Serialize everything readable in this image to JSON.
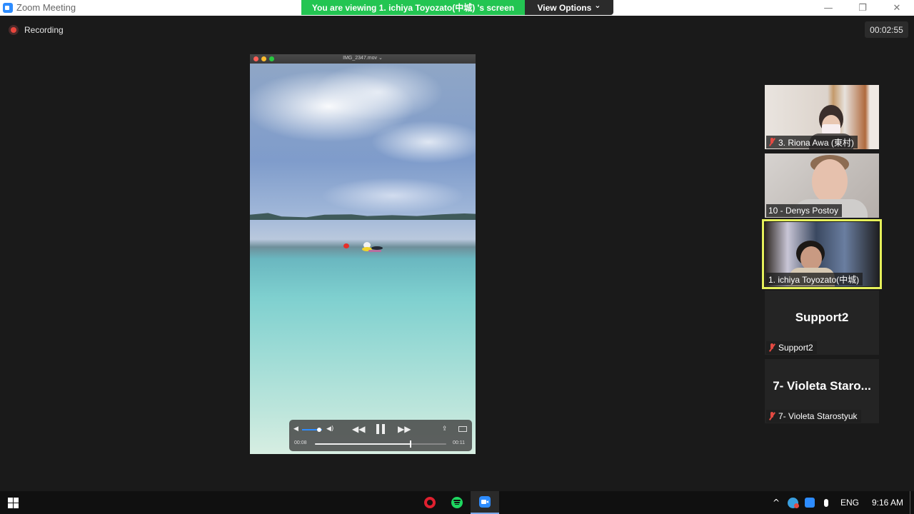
{
  "window": {
    "title": "Zoom Meeting",
    "controls": {
      "minimize": "—",
      "restore": "❐",
      "close": "✕"
    }
  },
  "share_banner": {
    "viewing_text": "You are viewing 1. ichiya Toyozato(中城) 's screen",
    "view_options_label": "View Options",
    "view_options_chevron": "⌄",
    "banner_color": "#23c552"
  },
  "recording": {
    "label": "Recording",
    "color": "#e8453c"
  },
  "meeting_timer": "00:02:55",
  "shared_screen": {
    "filename": "IMG_2347.mov ⌄",
    "current_time": "00:08",
    "duration": "00:11",
    "progress": 0.73,
    "volume_level": 0.75
  },
  "participants": [
    {
      "name": "3. Riona Awa (東村)",
      "muted": true,
      "video": true,
      "active": false
    },
    {
      "name": "10 - Denys Postoy",
      "muted": false,
      "video": true,
      "active": false
    },
    {
      "name": "1. ichiya Toyozato(中城)",
      "muted": false,
      "video": true,
      "active": true
    },
    {
      "name": "Support2",
      "display_name": "Support2",
      "muted": true,
      "video": false,
      "active": false
    },
    {
      "name": "7- Violeta Starostyuk",
      "display_name": "7- Violeta Staro...",
      "muted": true,
      "video": false,
      "active": false
    }
  ],
  "active_speaker_color": "#e5f05a",
  "taskbar": {
    "apps": [
      "opera",
      "spotify",
      "zoom"
    ],
    "active_app": "zoom",
    "tray": {
      "language": "ENG",
      "clock": "9:16 AM",
      "chevron": "^"
    }
  }
}
